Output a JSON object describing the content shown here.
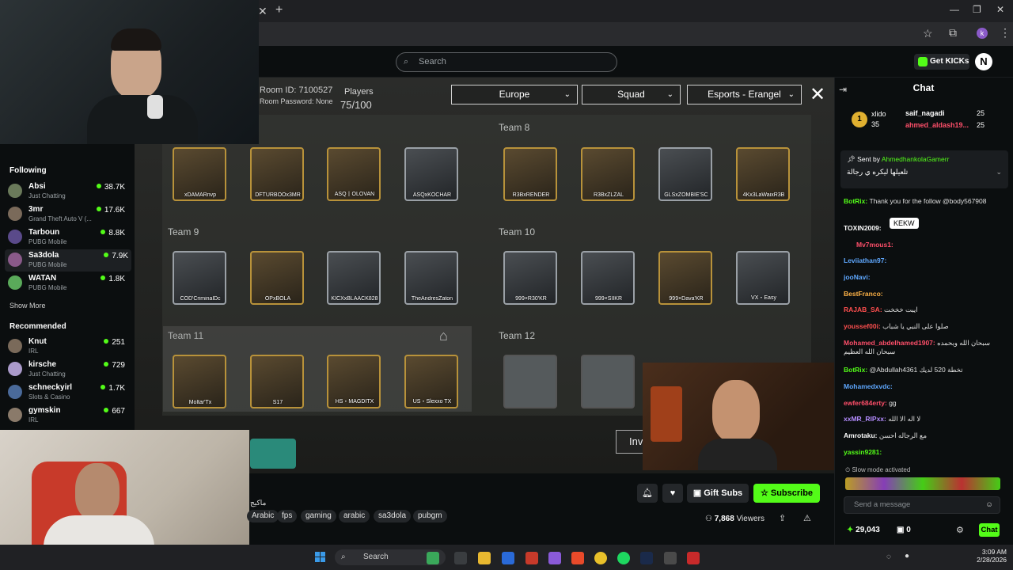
{
  "kick": {
    "search_placeholder": "Search",
    "get_kicks": "Get KICKs",
    "avatar_letter": "N"
  },
  "sidebar": {
    "following_heading": "Following",
    "following": [
      {
        "name": "Absi",
        "game": "Just Chatting",
        "viewers": "38.7K",
        "color": "#6a7a5a"
      },
      {
        "name": "3mr",
        "game": "Grand Theft Auto V (...",
        "viewers": "17.6K",
        "color": "#7a6a5a"
      },
      {
        "name": "Tarboun",
        "game": "PUBG Mobile",
        "viewers": "8.8K",
        "color": "#5a4a8a"
      },
      {
        "name": "Sa3dola",
        "game": "PUBG Mobile",
        "viewers": "7.9K",
        "color": "#8a5a8a"
      },
      {
        "name": "WATAN",
        "game": "PUBG Mobile",
        "viewers": "1.8K",
        "color": "#5aaa5a"
      }
    ],
    "show_more": "Show More",
    "recommended_heading": "Recommended",
    "recommended": [
      {
        "name": "Knut",
        "game": "IRL",
        "viewers": "251",
        "color": "#7a6a5a"
      },
      {
        "name": "kirsche",
        "game": "Just Chatting",
        "viewers": "729",
        "color": "#aa9aca"
      },
      {
        "name": "schneckyirl",
        "game": "Slots & Casino",
        "viewers": "1.7K",
        "color": "#4a6a9a"
      },
      {
        "name": "gymskin",
        "game": "IRL",
        "viewers": "667",
        "color": "#8a7a6a"
      }
    ]
  },
  "game": {
    "room_id": "Room ID: 7100527",
    "room_password": "Room Password: None",
    "players_label": "Players",
    "players_count": "75/100",
    "region": "Europe",
    "mode": "Squad",
    "map": "Esports - Erangel",
    "teams": [
      {
        "label": "Team 8",
        "players": [
          "xDAMARnvp",
          "DFTURBOOx3MR",
          "ASQ丨OLOVAN",
          "ASQxKOCHAR"
        ]
      },
      {
        "label": "Team 8",
        "players": [
          "R3BxRENDER",
          "R3BxZLZAL",
          "GLSxZOMBIE'SC",
          "4Kx3LaWaixR3B"
        ]
      },
      {
        "label": "Team 9",
        "players": [
          "COD'CriminalDc",
          "OPxBOLA",
          "KICXxBLAACK828",
          "TheAndresZaton"
        ]
      },
      {
        "label": "Team 10",
        "players": [
          "999×R30'KR",
          "999×SIIKR",
          "999×Dava'KR",
          "VX・Easy"
        ]
      },
      {
        "label": "Team 11",
        "players": [
          "Moltar'Tx",
          "S17",
          "HS・MAGDITX",
          "US・Slexxo TX"
        ]
      },
      {
        "label": "Team 12",
        "players": [
          "",
          ""
        ]
      }
    ],
    "invite_partial": "Inv"
  },
  "stream_info": {
    "category_partial": "ماكيج",
    "tags": [
      "Arabic",
      "fps",
      "gaming",
      "arabic",
      "sa3dola",
      "pubgm"
    ],
    "gift_subs": "Gift Subs",
    "subscribe": "Subscribe",
    "viewers_count": "7,868",
    "viewers_label": "Viewers"
  },
  "chat": {
    "title": "Chat",
    "gifters": [
      {
        "rank": "1",
        "name": "xlido",
        "count": "35"
      },
      {
        "name": "saif_nagadi",
        "count": "25"
      },
      {
        "name": "ahmed_aldash19...",
        "count": "25"
      }
    ],
    "pinned_sent_by": "Sent by",
    "pinned_user": "AhmedhankolaGamerr",
    "pinned_text": "تلعيلها ليكره ي رجالة",
    "tooltip": "KEKW",
    "messages": [
      {
        "user": "BotRix:",
        "text": "Thank you for the follow @body567908",
        "color": "#53fc18"
      },
      {
        "user": "TOXIN2009:",
        "text": "",
        "color": "#ffffff"
      },
      {
        "user": "Mv7mous1:",
        "text": "",
        "color": "#ff4f6a"
      },
      {
        "user": "Leviiathan97:",
        "text": "",
        "color": "#5fa8ff"
      },
      {
        "user": "jooNavi:",
        "text": "",
        "color": "#5fa8ff"
      },
      {
        "user": "BestFranco:",
        "text": "",
        "color": "#ffb347"
      },
      {
        "user": "RAJAB_SA:",
        "text": "ايبت خخخت",
        "color": "#ff4f4f"
      },
      {
        "user": "youssef00i:",
        "text": "صلوا على النبي يا شباب",
        "color": "#ff4f4f"
      },
      {
        "user": "Mohamed_abdelhamed1907:",
        "text": "سبحان الله وبحمده سبحان الله العظيم",
        "color": "#ff4f6a"
      },
      {
        "user": "BotRix:",
        "text": "@Abdullah4361 تخطة 520 لديك",
        "color": "#53fc18"
      },
      {
        "user": "Mohamedxvdc:",
        "text": "",
        "color": "#5fa8ff"
      },
      {
        "user": "ewfer684erty:",
        "text": "gg",
        "color": "#ff4f6a"
      },
      {
        "user": "xxMR_RIPxx:",
        "text": "لا اله الا الله",
        "color": "#b48cff"
      },
      {
        "user": "Amrotaku:",
        "text": "مع الرجاله احسن",
        "color": "#ffffff"
      },
      {
        "user": "yassin9281:",
        "text": "",
        "color": "#53fc18"
      }
    ],
    "slow_mode": "Slow mode activated",
    "input_placeholder": "Send a message",
    "points": "29,043",
    "redeem_count": "0",
    "send_label": "Chat"
  },
  "taskbar": {
    "search": "Search",
    "time": "3:09 AM",
    "date": "2/28/2026"
  },
  "colors": {
    "kick_green": "#53fc18",
    "gold_frame": "#b8923a"
  }
}
